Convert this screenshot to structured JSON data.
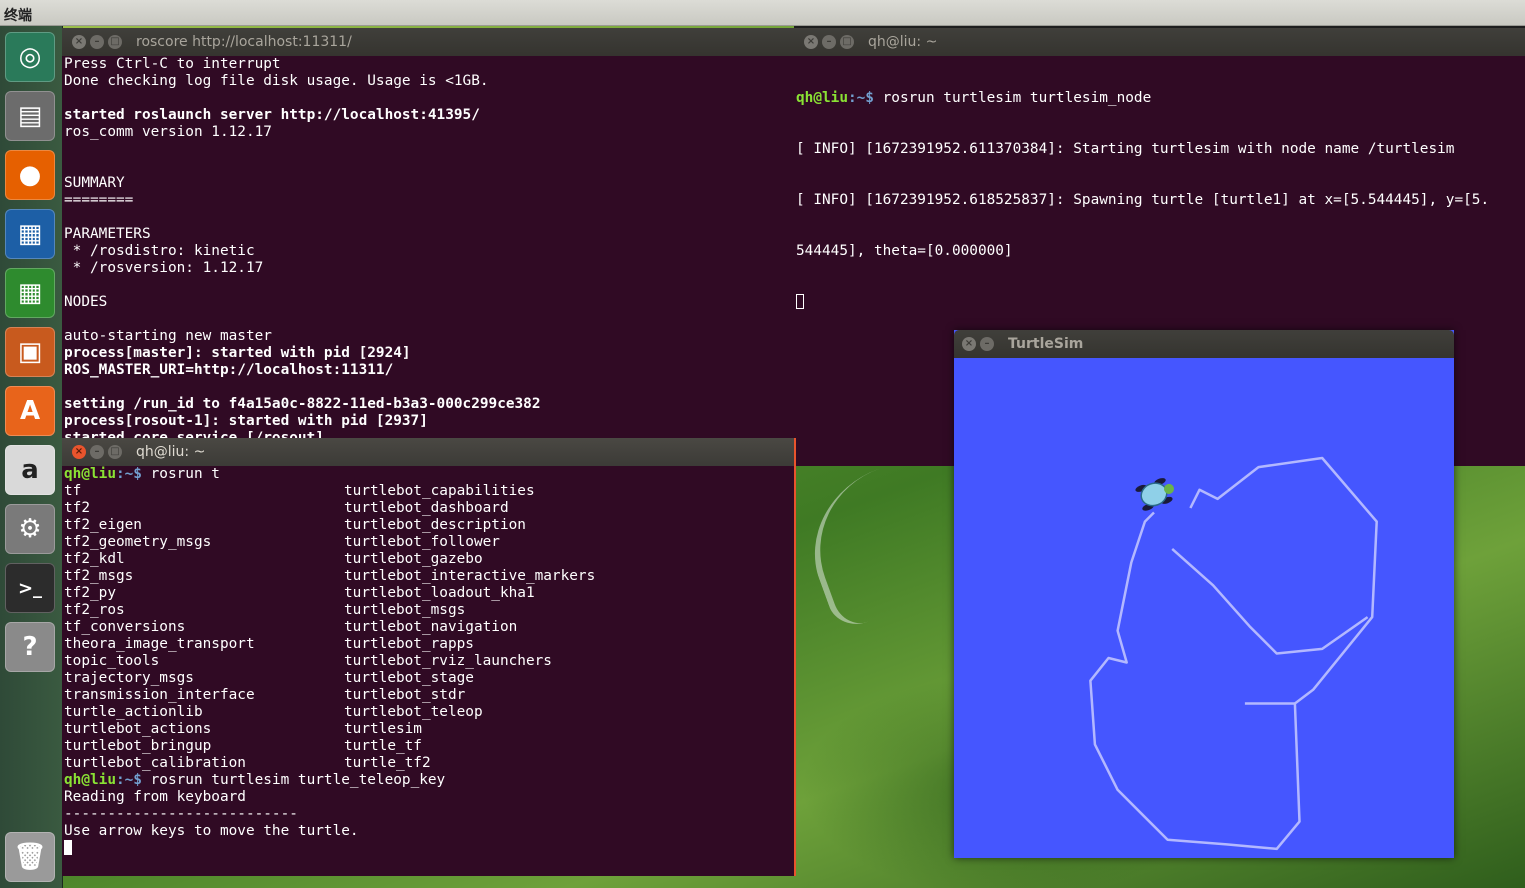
{
  "top_panel": {
    "title": "终端"
  },
  "launcher": {
    "items": [
      {
        "name": "ubuntu-dash-icon",
        "color": "#2a7a5a"
      },
      {
        "name": "files-icon",
        "color": "#6c6c6c"
      },
      {
        "name": "firefox-icon",
        "color": "#e66000"
      },
      {
        "name": "libreoffice-writer-icon",
        "color": "#1d5fa6"
      },
      {
        "name": "libreoffice-calc-icon",
        "color": "#2e8b2e"
      },
      {
        "name": "libreoffice-impress-icon",
        "color": "#c85a1e"
      },
      {
        "name": "software-center-icon",
        "color": "#e8641b"
      },
      {
        "name": "amazon-icon",
        "color": "#d9d9d9"
      },
      {
        "name": "system-settings-icon",
        "color": "#7a7a7a"
      },
      {
        "name": "terminal-icon",
        "color": "#2c2c2c"
      },
      {
        "name": "help-icon",
        "color": "#8a8a8a"
      },
      {
        "name": "trash-icon",
        "color": "#9a9a9a"
      }
    ]
  },
  "roscore_window": {
    "title": "roscore http://localhost:11311/",
    "lines": [
      {
        "t": "Press Ctrl-C to interrupt",
        "b": false
      },
      {
        "t": "Done checking log file disk usage. Usage is <1GB.",
        "b": false
      },
      {
        "t": "",
        "b": false
      },
      {
        "t": "started roslaunch server http://localhost:41395/",
        "b": true
      },
      {
        "t": "ros_comm version 1.12.17",
        "b": false
      },
      {
        "t": "",
        "b": false
      },
      {
        "t": "",
        "b": false
      },
      {
        "t": "SUMMARY",
        "b": false
      },
      {
        "t": "========",
        "b": false
      },
      {
        "t": "",
        "b": false
      },
      {
        "t": "PARAMETERS",
        "b": false
      },
      {
        "t": " * /rosdistro: kinetic",
        "b": false
      },
      {
        "t": " * /rosversion: 1.12.17",
        "b": false
      },
      {
        "t": "",
        "b": false
      },
      {
        "t": "NODES",
        "b": false
      },
      {
        "t": "",
        "b": false
      },
      {
        "t": "auto-starting new master",
        "b": false
      },
      {
        "t": "process[master]: started with pid [2924]",
        "b": true
      },
      {
        "t": "ROS_MASTER_URI=http://localhost:11311/",
        "b": true
      },
      {
        "t": "",
        "b": false
      },
      {
        "t": "setting /run_id to f4a15a0c-8822-11ed-b3a3-000c299ce382",
        "b": true
      },
      {
        "t": "process[rosout-1]: started with pid [2937]",
        "b": true
      },
      {
        "t": "started core service [/rosout]",
        "b": true
      }
    ]
  },
  "turtlesim_term": {
    "title": "qh@liu: ~",
    "prompt_user": "qh@liu",
    "prompt_path": ":~$",
    "command": " rosrun turtlesim turtlesim_node",
    "lines": [
      "[ INFO] [1672391952.611370384]: Starting turtlesim with node name /turtlesim",
      "[ INFO] [1672391952.618525837]: Spawning turtle [turtle1] at x=[5.544445], y=[5.",
      "544445], theta=[0.000000]"
    ]
  },
  "teleop_term": {
    "title": "qh@liu: ~",
    "prompt_user": "qh@liu",
    "prompt_path": ":~$",
    "command1": " rosrun t",
    "col1": [
      "tf",
      "tf2",
      "tf2_eigen",
      "tf2_geometry_msgs",
      "tf2_kdl",
      "tf2_msgs",
      "tf2_py",
      "tf2_ros",
      "tf_conversions",
      "theora_image_transport",
      "topic_tools",
      "trajectory_msgs",
      "transmission_interface",
      "turtle_actionlib",
      "turtlebot_actions",
      "turtlebot_bringup",
      "turtlebot_calibration"
    ],
    "col2": [
      "turtlebot_capabilities",
      "turtlebot_dashboard",
      "turtlebot_description",
      "turtlebot_follower",
      "turtlebot_gazebo",
      "turtlebot_interactive_markers",
      "turtlebot_loadout_kha1",
      "turtlebot_msgs",
      "turtlebot_navigation",
      "turtlebot_rapps",
      "turtlebot_rviz_launchers",
      "turtlebot_stage",
      "turtlebot_stdr",
      "turtlebot_teleop",
      "turtlesim",
      "turtle_tf",
      "turtle_tf2"
    ],
    "command2": " rosrun turtlesim turtle_teleop_key",
    "after": [
      "Reading from keyboard",
      "---------------------------",
      "Use arrow keys to move the turtle."
    ]
  },
  "turtlesim_window": {
    "title": "TurtleSim",
    "background": "#4556ff",
    "path_color": "#b3b8ff",
    "path": [
      [
        5.2,
        3.3
      ],
      [
        5.4,
        2.9
      ],
      [
        5.8,
        3.1
      ],
      [
        6.7,
        2.4
      ],
      [
        8.1,
        2.2
      ],
      [
        9.3,
        3.6
      ],
      [
        9.2,
        5.7
      ],
      [
        7.9,
        7.3
      ],
      [
        7.5,
        7.6
      ],
      [
        7.6,
        10.2
      ],
      [
        7.1,
        10.8
      ],
      [
        6.0,
        10.7
      ],
      [
        4.7,
        10.6
      ],
      [
        3.6,
        9.5
      ],
      [
        3.1,
        8.5
      ],
      [
        3.0,
        7.1
      ],
      [
        3.4,
        6.6
      ],
      [
        3.8,
        6.7
      ],
      [
        3.6,
        6.0
      ],
      [
        3.9,
        4.5
      ],
      [
        4.2,
        3.6
      ],
      [
        4.4,
        3.4
      ]
    ],
    "path2": [
      [
        4.8,
        4.2
      ],
      [
        5.7,
        5.0
      ],
      [
        6.5,
        5.9
      ],
      [
        7.1,
        6.5
      ],
      [
        8.1,
        6.4
      ],
      [
        9.1,
        5.7
      ]
    ],
    "path3": [
      [
        7.5,
        7.6
      ],
      [
        6.4,
        7.6
      ]
    ],
    "turtle": {
      "x": 4.4,
      "y": 3.0,
      "theta_deg": -20
    }
  }
}
